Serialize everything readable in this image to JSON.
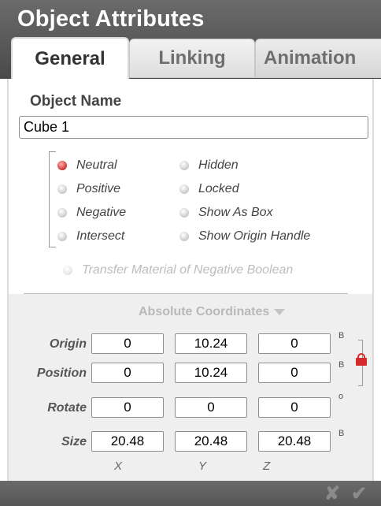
{
  "window": {
    "title": "Object Attributes"
  },
  "tabs": [
    {
      "label": "General",
      "active": true
    },
    {
      "label": "Linking",
      "active": false
    },
    {
      "label": "Animation",
      "active": false
    }
  ],
  "object_name": {
    "label": "Object Name",
    "value": "Cube 1"
  },
  "boolean_options": [
    {
      "label": "Neutral",
      "selected": true
    },
    {
      "label": "Positive",
      "selected": false
    },
    {
      "label": "Negative",
      "selected": false
    },
    {
      "label": "Intersect",
      "selected": false
    }
  ],
  "display_options": [
    {
      "label": "Hidden"
    },
    {
      "label": "Locked"
    },
    {
      "label": "Show As Box"
    },
    {
      "label": "Show Origin Handle"
    }
  ],
  "transfer_material": {
    "label": "Transfer Material of Negative Boolean",
    "enabled": false
  },
  "coordinates": {
    "mode": "Absolute Coordinates",
    "rows": [
      {
        "label": "Origin",
        "x": "0",
        "y": "10.24",
        "z": "0",
        "unit": "B"
      },
      {
        "label": "Position",
        "x": "0",
        "y": "10.24",
        "z": "0",
        "unit": "B"
      },
      {
        "label": "Rotate",
        "x": "0",
        "y": "0",
        "z": "0",
        "unit": "o"
      },
      {
        "label": "Size",
        "x": "20.48",
        "y": "20.48",
        "z": "20.48",
        "unit": "B"
      }
    ],
    "axes": [
      "X",
      "Y",
      "Z"
    ]
  },
  "footer": {
    "cancel_glyph": "✘",
    "ok_glyph": "✔"
  },
  "colors": {
    "header_bg": "#555555",
    "selected_radio": "#d23a3a",
    "lock": "#d42a2a"
  },
  "icons": {
    "lock": "lock-icon",
    "dropdown": "chevron-down-icon"
  }
}
